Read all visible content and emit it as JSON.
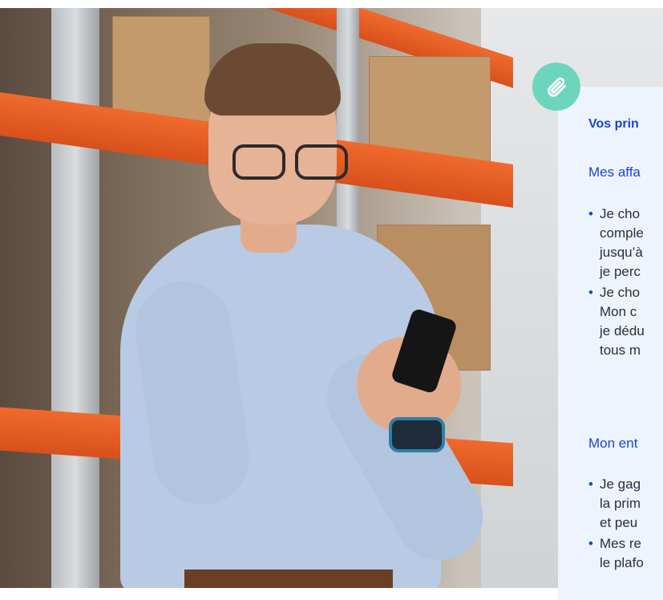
{
  "card": {
    "title": "Vos prin",
    "section1": {
      "heading": "Mes affa",
      "items": [
        {
          "lines": [
            "Je cho",
            "comple",
            "jusqu’à",
            "je perc"
          ]
        },
        {
          "lines": [
            "Je cho",
            "Mon c",
            "je dédu",
            "tous m"
          ]
        }
      ]
    },
    "section2": {
      "heading": "Mon ent",
      "items": [
        {
          "lines": [
            "Je gag",
            "la prim",
            "et peu"
          ]
        },
        {
          "lines": [
            "Mes re",
            "le plafo"
          ]
        }
      ]
    }
  },
  "icons": {
    "attachment": "paperclip-icon"
  },
  "colors": {
    "accent": "#1a46c8",
    "badge": "#6ed5bd",
    "card_bg": "#edf4fd"
  }
}
